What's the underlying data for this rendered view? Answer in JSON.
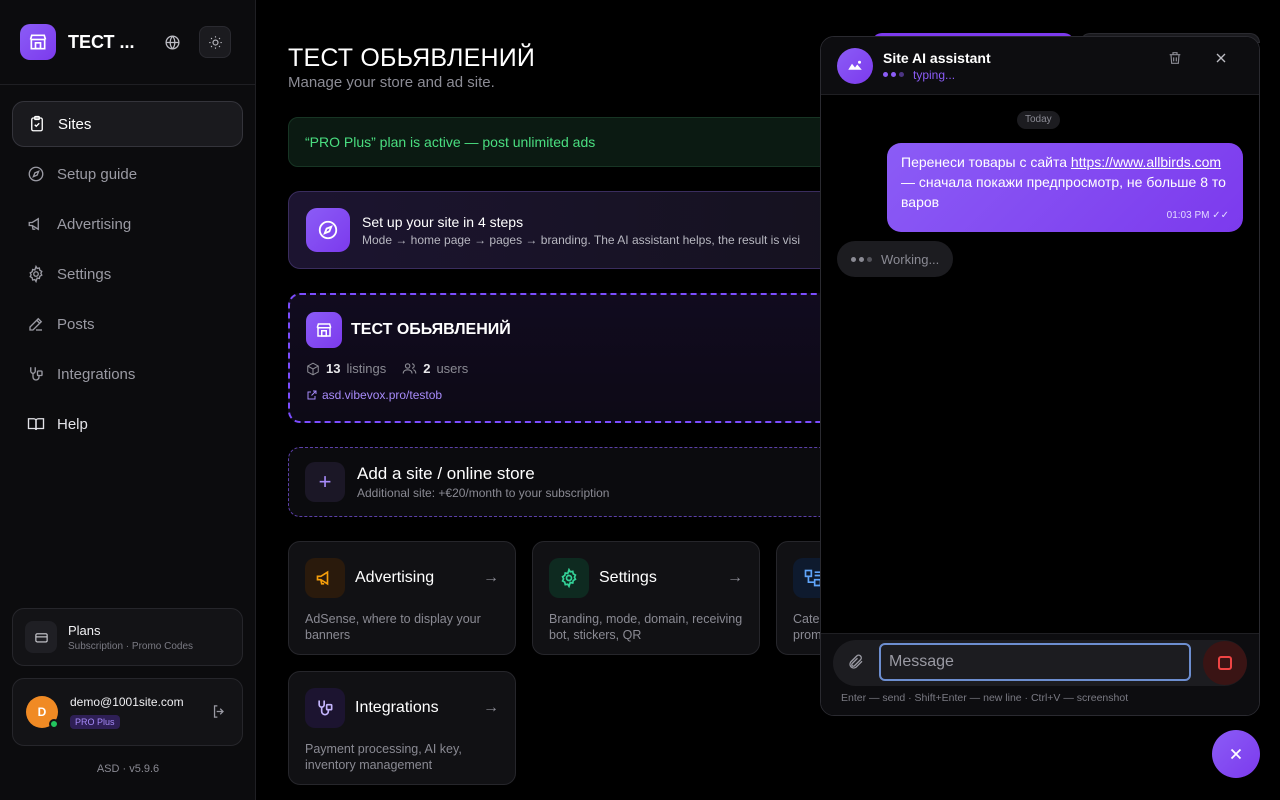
{
  "sidebar": {
    "brand": "ТЕСТ ...",
    "nav": [
      {
        "label": "Sites",
        "icon": "clipboard-check-icon"
      },
      {
        "label": "Setup guide",
        "icon": "compass-icon"
      },
      {
        "label": "Advertising",
        "icon": "megaphone-icon"
      },
      {
        "label": "Settings",
        "icon": "gear-icon"
      },
      {
        "label": "Posts",
        "icon": "pen-icon"
      },
      {
        "label": "Integrations",
        "icon": "plug-icon"
      },
      {
        "label": "Help",
        "icon": "book-icon"
      }
    ],
    "plans": {
      "title": "Plans",
      "subtitle": "Subscription · Promo Codes"
    },
    "user": {
      "initial": "D",
      "email": "demo@1001site.com",
      "badge": "PRO Plus"
    },
    "version": "ASD · v5.9.6"
  },
  "main": {
    "title": "ТЕСТ ОБЬЯВЛЕНИЙ",
    "subtitle": "Manage your store and ad site.",
    "plan_banner": "“PRO Plus” plan is active — post unlimited ads",
    "setup": {
      "title": "Set up your site in 4 steps",
      "subtitle": "Mode → home page → pages → branding. The AI assistant helps, the result is visi"
    },
    "site": {
      "name": "ТЕСТ ОБЬЯВЛЕНИЙ",
      "listings_count": "13",
      "listings_label": "listings",
      "users_count": "2",
      "users_label": "users",
      "url": "asd.vibevox.pro/testob"
    },
    "add_site": {
      "title": "Add a site / online store",
      "subtitle": "Additional site: +€20/month to your subscription"
    },
    "tiles": [
      {
        "title": "Advertising",
        "desc": "AdSense, where to display your banners",
        "icon": "megaphone-icon"
      },
      {
        "title": "Settings",
        "desc": "Branding, mode, domain, receiving bot, stickers, QR",
        "icon": "gear-icon"
      },
      {
        "title": "",
        "desc": "Cate prom",
        "icon": "categories-icon"
      },
      {
        "title": "Integrations",
        "desc": "Payment processing, AI key, inventory management",
        "icon": "plug-icon"
      }
    ]
  },
  "chat": {
    "title": "Site AI assistant",
    "status": "typing...",
    "day": "Today",
    "message": {
      "text_before": "Перенеси товары с сайта ",
      "link": "https://www.allbirds.com",
      "text_after": " — сначала покажи предпросмотр, не больше 8 товаров",
      "time": "01:03 PM"
    },
    "working": "Working...",
    "input_placeholder": "Message",
    "hint": "Enter — send · Shift+Enter — new line · Ctrl+V — screenshot"
  },
  "colors": {
    "accent": "#8b5cf6",
    "success": "#4ade80",
    "danger": "#ef4444"
  }
}
